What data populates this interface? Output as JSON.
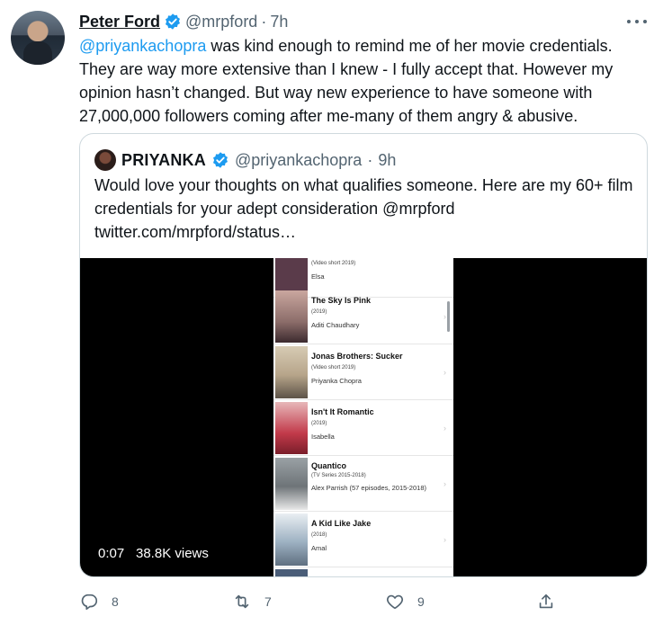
{
  "tweet": {
    "author_name": "Peter Ford",
    "author_handle": "@mrpford",
    "separator": "·",
    "time": "7h",
    "mention": "@priyankachopra",
    "text_after_mention": " was kind enough to remind me of her movie credentials. They are way more extensive than I knew - I fully accept that.  However my opinion hasn’t changed. But way new experience to have someone with 27,000,000 followers coming after me-many of them angry & abusive."
  },
  "quote": {
    "author_name": "PRIYANKA",
    "author_handle": "@priyankachopra",
    "separator": "·",
    "time": "9h",
    "text": "Would love your thoughts on what qualifies someone. Here are my 60+ film credentials for your adept consideration @mrpford twitter.com/mrpford/status…",
    "video": {
      "elapsed": "0:07",
      "views": "38.8K views",
      "films": [
        {
          "title": "",
          "year": "(Video short 2019)",
          "role": "Elsa",
          "poster_color": "#5a3b4a"
        },
        {
          "title": "The Sky Is Pink",
          "year": "(2019)",
          "role": "Aditi Chaudhary",
          "poster_color": "#8c6d6a"
        },
        {
          "title": "Jonas Brothers: Sucker",
          "year": "(Video short 2019)",
          "role": "Priyanka Chopra",
          "poster_color": "#b7a58a"
        },
        {
          "title": "Isn't It Romantic",
          "year": "(2019)",
          "role": "Isabella",
          "poster_color": "#c23a4a"
        },
        {
          "title": "Quantico",
          "year": "(TV Series 2015-2018)",
          "role": "Alex Parrish (57 episodes, 2015-2018)",
          "poster_color": "#6e7478"
        },
        {
          "title": "A Kid Like Jake",
          "year": "(2018)",
          "role": "Amal",
          "poster_color": "#9db1c2"
        }
      ]
    }
  },
  "actions": {
    "reply_count": "8",
    "retweet_count": "7",
    "like_count": "9"
  },
  "colors": {
    "accent": "#1d9bf0",
    "secondary_text": "#536471",
    "border": "#cfd9de"
  },
  "icons": [
    "verified-badge-icon",
    "more-icon",
    "reply-icon",
    "retweet-icon",
    "like-icon",
    "share-icon",
    "chevron-right-icon"
  ]
}
